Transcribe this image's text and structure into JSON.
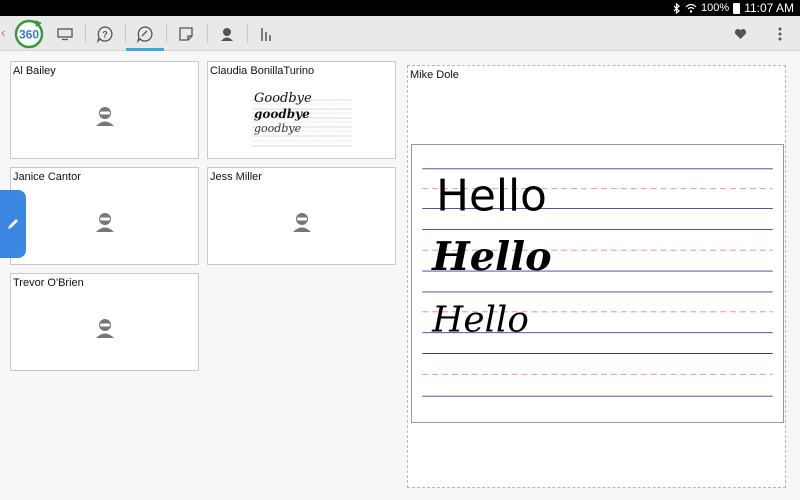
{
  "status_bar": {
    "battery": "100%",
    "time": "11:07 AM",
    "icons": [
      "bluetooth-icon",
      "wifi-icon",
      "battery-icon"
    ]
  },
  "toolbar": {
    "logo_text": "360",
    "back_icon": "chevron-left-icon",
    "buttons": [
      {
        "name": "screen-icon"
      },
      {
        "name": "question-bubble-icon"
      },
      {
        "name": "answer-bubble-icon",
        "active": true
      },
      {
        "name": "note-icon"
      },
      {
        "name": "student-icon"
      },
      {
        "name": "bar-chart-icon"
      }
    ],
    "right_icons": [
      "heart-icon",
      "overflow-menu-icon"
    ],
    "accent_color": "#3fa7dc"
  },
  "students": [
    {
      "name": "Al Bailey",
      "has_work": false
    },
    {
      "name": "Claudia BonillaTurino",
      "has_work": true,
      "work_lines": [
        "Goodbye",
        "goodbye",
        "goodbye"
      ]
    },
    {
      "name": "Janice Cantor",
      "has_work": false
    },
    {
      "name": "Jess Miller",
      "has_work": false
    },
    {
      "name": "Trevor O'Brien",
      "has_work": false
    }
  ],
  "selected_student": {
    "name": "Mike Dole",
    "work_lines": [
      "Hello",
      "Hello",
      "Hello"
    ]
  },
  "edit_tab_icon": "pencil-icon"
}
